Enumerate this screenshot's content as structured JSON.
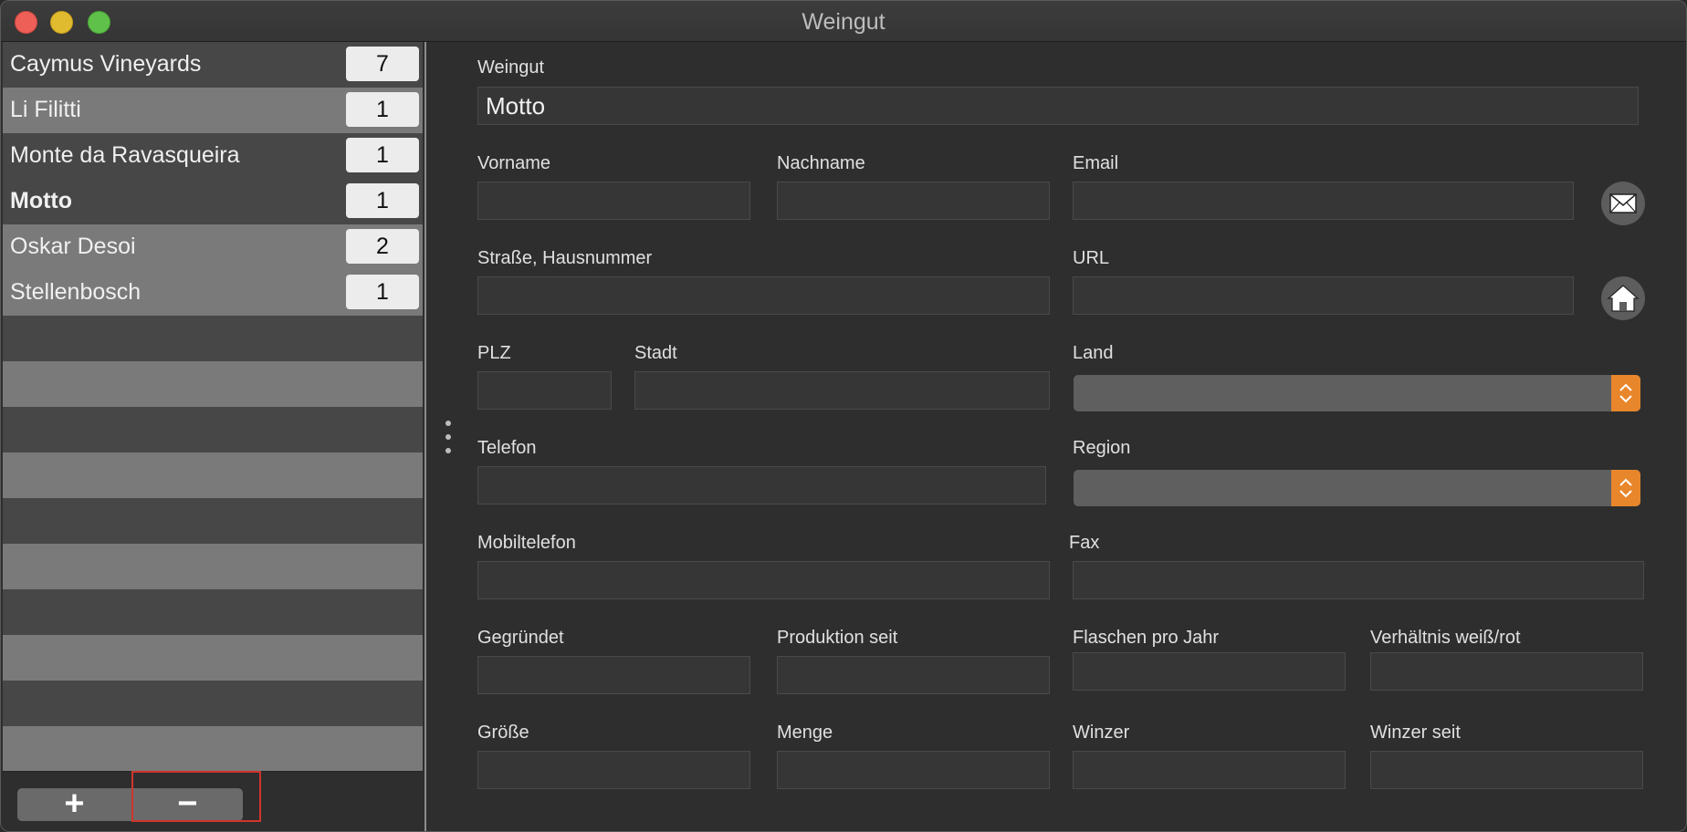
{
  "window": {
    "title": "Weingut"
  },
  "sidebar": {
    "items": [
      {
        "name": "Caymus Vineyards",
        "count": "7"
      },
      {
        "name": "Li Filitti",
        "count": "1"
      },
      {
        "name": "Monte da Ravasqueira",
        "count": "1"
      },
      {
        "name": "Motto",
        "count": "1",
        "selected": true
      },
      {
        "name": "Oskar Desoi",
        "count": "2"
      },
      {
        "name": "Stellenbosch",
        "count": "1"
      }
    ],
    "add_label": "+",
    "remove_label": "−"
  },
  "form": {
    "weingut": {
      "label": "Weingut",
      "value": "Motto"
    },
    "vorname": {
      "label": "Vorname",
      "value": ""
    },
    "nachname": {
      "label": "Nachname",
      "value": ""
    },
    "email": {
      "label": "Email",
      "value": ""
    },
    "strasse": {
      "label": "Straße, Hausnummer",
      "value": ""
    },
    "url": {
      "label": "URL",
      "value": ""
    },
    "plz": {
      "label": "PLZ",
      "value": ""
    },
    "stadt": {
      "label": "Stadt",
      "value": ""
    },
    "land": {
      "label": "Land",
      "value": ""
    },
    "telefon": {
      "label": "Telefon",
      "value": ""
    },
    "region": {
      "label": "Region",
      "value": ""
    },
    "mobiltelefon": {
      "label": "Mobiltelefon",
      "value": ""
    },
    "fax": {
      "label": "Fax",
      "value": ""
    },
    "gegruendet": {
      "label": "Gegründet",
      "value": ""
    },
    "produktion_seit": {
      "label": "Produktion seit",
      "value": ""
    },
    "flaschen_pro_jahr": {
      "label": "Flaschen pro Jahr",
      "value": ""
    },
    "verhaeltnis": {
      "label": "Verhältnis weiß/rot",
      "value": ""
    },
    "groesse": {
      "label": "Größe",
      "value": ""
    },
    "menge": {
      "label": "Menge",
      "value": ""
    },
    "winzer": {
      "label": "Winzer",
      "value": ""
    },
    "winzer_seit": {
      "label": "Winzer seit",
      "value": ""
    }
  },
  "colors": {
    "accent_popup": "#e8862b",
    "highlight_box": "#d0352b"
  },
  "icons": {
    "email_button": "envelope-icon",
    "url_button": "home-icon"
  }
}
